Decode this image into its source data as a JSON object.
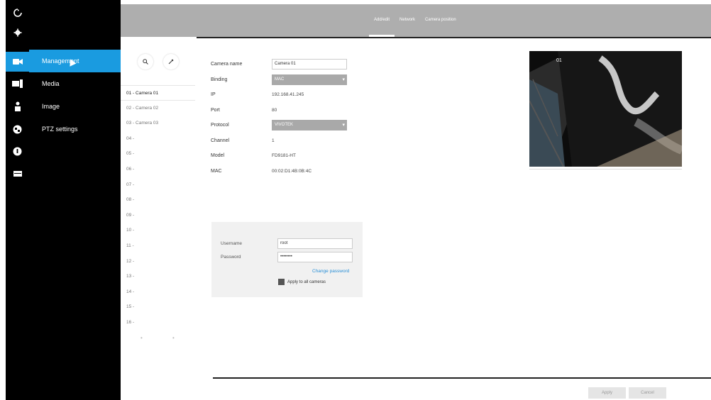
{
  "rail": {
    "icons": [
      "monitor-icon",
      "settings-icon",
      "camera-icon",
      "media-icon",
      "user-icon",
      "network-icon",
      "info-icon",
      "storage-icon"
    ]
  },
  "submenu": {
    "items": [
      {
        "label": "Management",
        "active": true
      },
      {
        "label": "Media",
        "active": false
      },
      {
        "label": "Image",
        "active": false
      },
      {
        "label": "PTZ settings",
        "active": false
      }
    ]
  },
  "tabs": [
    "Add/edit",
    "Network",
    "Camera position"
  ],
  "channels": [
    "01 - Camera 01",
    "02 - Camera 02",
    "03 - Camera 03",
    "04 -",
    "05 -",
    "06 -",
    "07 -",
    "08 -",
    "09 -",
    "10 -",
    "11 -",
    "12 -",
    "13 -",
    "14 -",
    "15 -",
    "16 -"
  ],
  "form": {
    "camera_name_label": "Camera name",
    "camera_name_value": "Camera 01",
    "binding_label": "Binding",
    "binding_value": "MAC",
    "ip_label": "IP",
    "ip_value": "192.168.41.245",
    "port_label": "Port",
    "port_value": "80",
    "protocol_label": "Protocol",
    "protocol_value": "VIVOTEK",
    "channel_label": "Channel",
    "channel_value": "1",
    "model_label": "Model",
    "model_value": "FD9181-HT",
    "mac_label": "MAC",
    "mac_value": "00:02:D1:4B:0B:4C"
  },
  "credentials": {
    "username_label": "Username",
    "username_value": "root",
    "password_label": "Password",
    "password_value": "••••••••",
    "change_password": "Change password",
    "apply_all": "Apply to all cameras"
  },
  "preview": {
    "label": "01"
  },
  "footer": {
    "apply_label": "Apply",
    "cancel_label": "Cancel"
  },
  "colors": {
    "accent": "#1a9be0",
    "sidebar": "#000000",
    "topbar": "#aeaeae"
  }
}
